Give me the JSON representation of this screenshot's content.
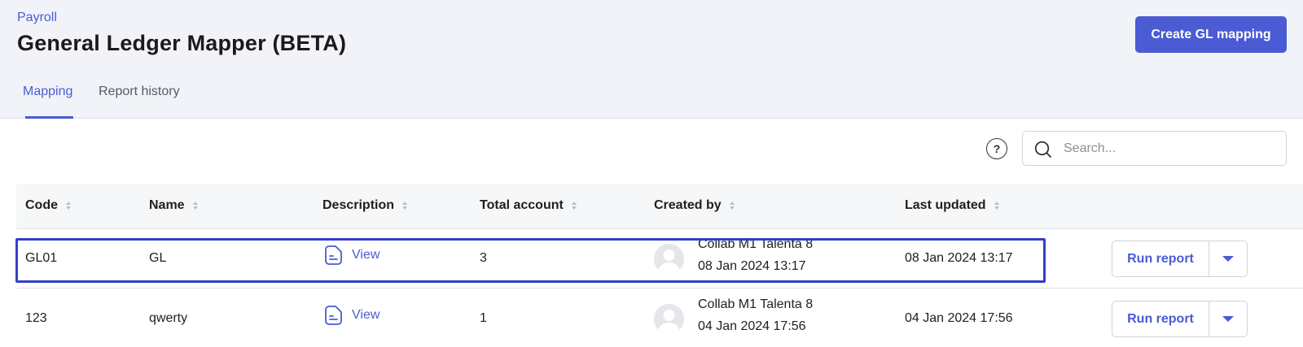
{
  "header": {
    "breadcrumb": "Payroll",
    "title": "General Ledger Mapper (BETA)",
    "create_button": "Create GL mapping",
    "tabs": [
      {
        "label": "Mapping",
        "active": true
      },
      {
        "label": "Report history",
        "active": false
      }
    ]
  },
  "toolbar": {
    "help_icon": "?",
    "search_placeholder": "Search..."
  },
  "table": {
    "columns": [
      "Code",
      "Name",
      "Description",
      "Total account",
      "Created by",
      "Last updated"
    ],
    "rows": [
      {
        "code": "GL01",
        "name": "GL",
        "description": "View",
        "total_account": "3",
        "created_by": "Collab M1 Talenta 8",
        "created_at": "08 Jan 2024 13:17",
        "last_updated": "08 Jan 2024 13:17",
        "run_label": "Run report"
      },
      {
        "code": "123",
        "name": "qwerty",
        "description": "View",
        "total_account": "1",
        "created_by": "Collab M1 Talenta 8",
        "created_at": "04 Jan 2024 17:56",
        "last_updated": "04 Jan 2024 17:56",
        "run_label": "Run report"
      }
    ]
  },
  "colors": {
    "accent": "#4a5bd4",
    "highlight_border": "#3340c4",
    "header_bg": "#f1f3f8"
  },
  "icons": {
    "search": "search-icon",
    "help": "help-icon",
    "description": "document-icon",
    "avatar": "user-avatar-icon",
    "dropdown": "caret-down-icon"
  }
}
